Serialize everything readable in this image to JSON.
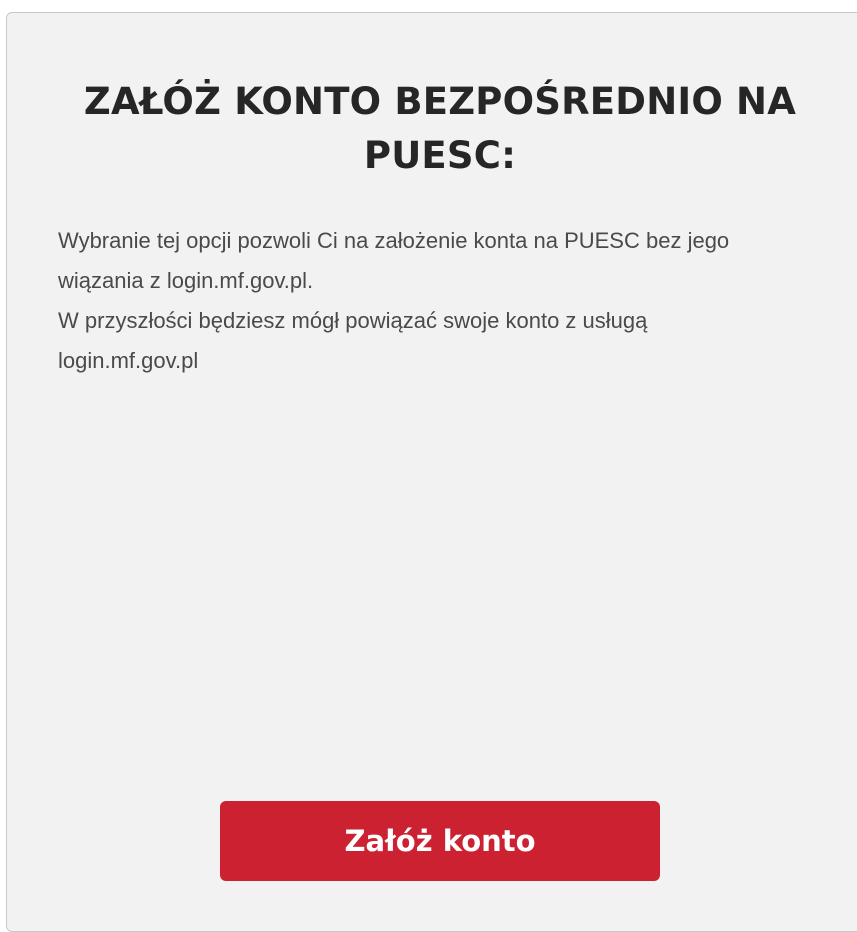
{
  "card": {
    "title_lines": [
      "ZAŁÓŻ KONTO BEZPOŚREDNIO NA",
      "PUESC:"
    ],
    "description_lines": [
      "Wybranie tej opcji pozwoli Ci na założenie konta na PUESC bez jego",
      "wiązania z login.mf.gov.pl.",
      "W przyszłości będziesz mógł powiązać swoje konto z usługą",
      "login.mf.gov.pl"
    ],
    "button_label": "Załóż konto"
  },
  "colors": {
    "card_background": "#f2f2f2",
    "card_border": "#c9c9c9",
    "title_text": "#262626",
    "body_text": "#4a4a4a",
    "button_background": "#cc2131",
    "button_text": "#ffffff"
  }
}
